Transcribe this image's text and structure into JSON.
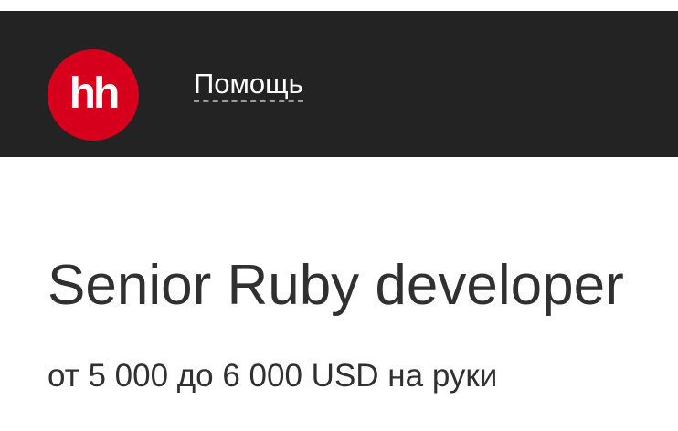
{
  "header": {
    "logo_text": "hh",
    "help_label": "Помощь",
    "brand_color": "#d6001c",
    "background_color": "#232323"
  },
  "vacancy": {
    "title": "Senior Ruby developer",
    "salary": "от 5 000 до 6 000 USD на руки"
  }
}
